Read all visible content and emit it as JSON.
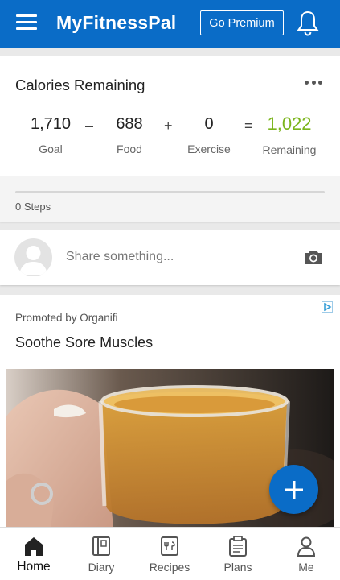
{
  "appbar": {
    "title": "MyFitnessPal",
    "premium_label": "Go Premium",
    "color": "#0a6cc7"
  },
  "calories": {
    "title": "Calories Remaining",
    "goal_value": "1,710",
    "goal_label": "Goal",
    "minus": "–",
    "food_value": "688",
    "food_label": "Food",
    "plus": "+",
    "exercise_value": "0",
    "exercise_label": "Exercise",
    "equals": "=",
    "remaining_value": "1,022",
    "remaining_label": "Remaining",
    "remaining_color": "#7bb51c"
  },
  "steps": {
    "text": "0 Steps",
    "progress": 0
  },
  "share": {
    "placeholder": "Share something..."
  },
  "promo": {
    "by": "Promoted by Organifi",
    "title": "Soothe Sore Muscles"
  },
  "bottom_nav": {
    "items": [
      {
        "label": "Home",
        "icon": "home-icon",
        "active": true
      },
      {
        "label": "Diary",
        "icon": "diary-icon",
        "active": false
      },
      {
        "label": "Recipes",
        "icon": "recipes-icon",
        "active": false
      },
      {
        "label": "Plans",
        "icon": "plans-icon",
        "active": false
      },
      {
        "label": "Me",
        "icon": "person-icon",
        "active": false
      }
    ]
  },
  "fab": {
    "icon": "plus-icon"
  }
}
